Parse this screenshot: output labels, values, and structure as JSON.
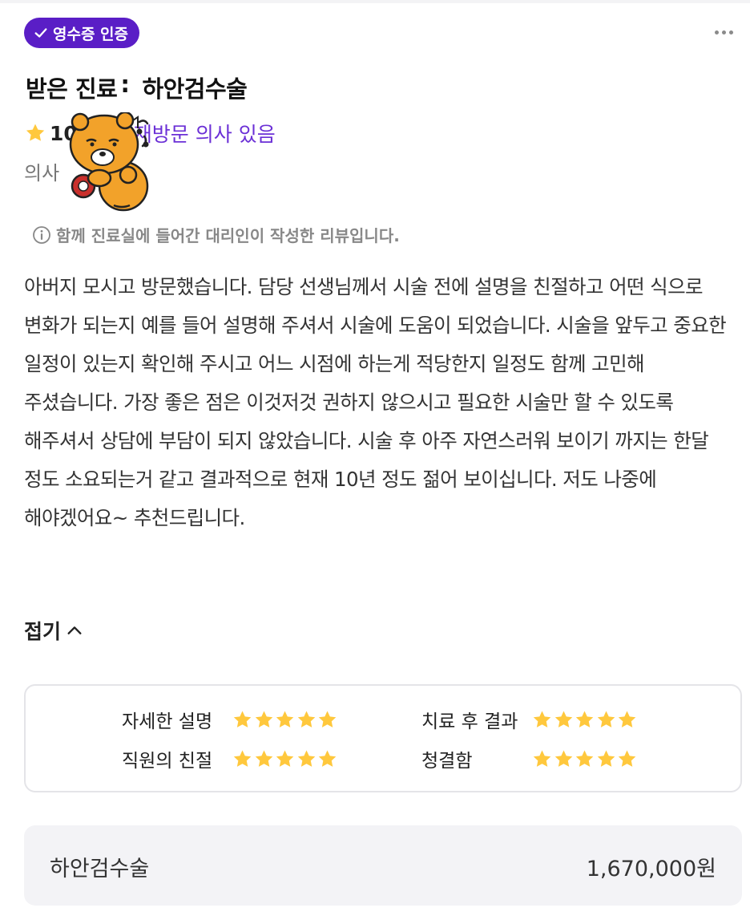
{
  "badge": {
    "label": "영수증 인증",
    "icon": "check-icon",
    "color": "#5a1ec6"
  },
  "menu": {
    "icon": "more-horizontal-icon"
  },
  "header": {
    "prefix": "받은 진료",
    "separator": ":",
    "treatment": "하안검수술"
  },
  "rating": {
    "score": "10",
    "revisit": "재방문 의사 있음",
    "star_color": "#ffc83d",
    "revisit_color": "#6b30d6"
  },
  "doctor": {
    "label": "의사"
  },
  "notice": {
    "icon": "info-icon",
    "text": "함께 진료실에 들어간 대리인이 작성한 리뷰입니다."
  },
  "review": {
    "text": "아버지 모시고 방문했습니다. 담당 선생님께서 시술 전에 설명을 친절하고 어떤 식으로 변화가 되는지 예를 들어 설명해 주셔서 시술에 도움이 되었습니다. 시술을 앞두고 중요한 일정이 있는지 확인해 주시고 어느 시점에 하는게 적당한지 일정도 함께 고민해 주셨습니다. 가장 좋은 점은 이것저것 권하지 않으시고 필요한 시술만 할 수 있도록 해주셔서 상담에 부담이 되지 않았습니다. 시술 후 아주 자연스러워 보이기 까지는 한달 정도 소요되는거 같고 결과적으로 현재 10년 정도 젊어 보이십니다. 저도 나중에 해야겠어요~ 추천드립니다."
  },
  "collapse": {
    "label": "접기",
    "icon": "chevron-up-icon"
  },
  "scores": [
    {
      "label": "자세한 설명",
      "stars": 5
    },
    {
      "label": "치료 후 결과",
      "stars": 5
    },
    {
      "label": "직원의 친절",
      "stars": 5
    },
    {
      "label": "청결함",
      "stars": 5
    }
  ],
  "price": {
    "item": "하안검수술",
    "amount": "1,670,000원"
  }
}
